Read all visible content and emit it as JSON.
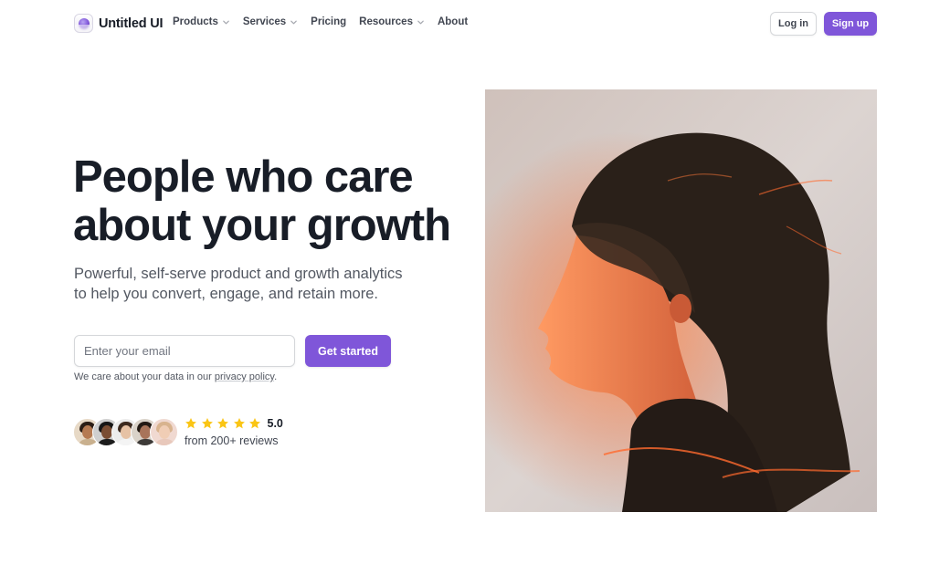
{
  "brand": {
    "name": "Untitled UI",
    "logo_icon": "orb-logo-icon",
    "accent_color": "#7f56d9"
  },
  "nav": {
    "items": [
      {
        "label": "Products",
        "dropdown": true
      },
      {
        "label": "Services",
        "dropdown": true
      },
      {
        "label": "Pricing",
        "dropdown": false
      },
      {
        "label": "Resources",
        "dropdown": true
      },
      {
        "label": "About",
        "dropdown": false
      }
    ]
  },
  "auth": {
    "login_label": "Log in",
    "signup_label": "Sign up"
  },
  "hero": {
    "title_line1": "People who care",
    "title_line2": "about your growth",
    "subtitle_line1": "Powerful, self-serve product and growth analytics",
    "subtitle_line2": "to help you convert, engage, and retain more.",
    "email_placeholder": "Enter your email",
    "email_value": "",
    "cta_label": "Get started",
    "privacy_prefix": "We care about your data in our ",
    "privacy_link": "privacy policy",
    "privacy_suffix": "."
  },
  "reviews": {
    "star_count": 5,
    "star_color": "#fac515",
    "rating": "5.0",
    "caption": "from 200+ reviews",
    "avatar_count": 5
  }
}
